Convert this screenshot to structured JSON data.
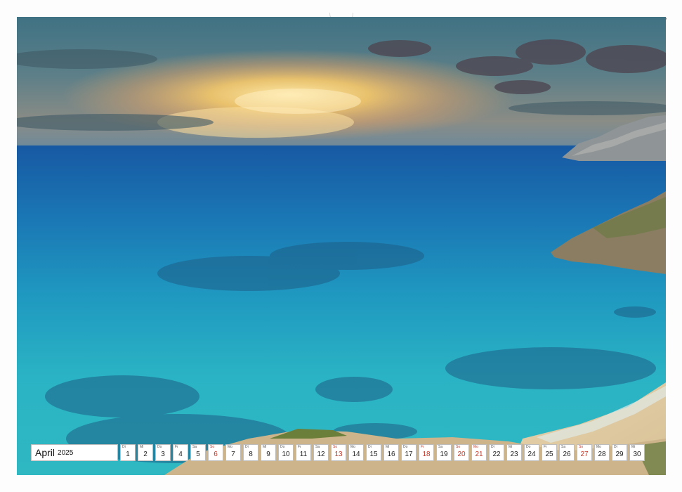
{
  "calendar": {
    "month": "April",
    "year": "2025",
    "days": [
      {
        "wd": "Di",
        "n": "1",
        "red": false
      },
      {
        "wd": "Mi",
        "n": "2",
        "red": false
      },
      {
        "wd": "Do",
        "n": "3",
        "red": false
      },
      {
        "wd": "Fr",
        "n": "4",
        "red": false
      },
      {
        "wd": "Sa",
        "n": "5",
        "red": false
      },
      {
        "wd": "So",
        "n": "6",
        "red": true
      },
      {
        "wd": "Mo",
        "n": "7",
        "red": false
      },
      {
        "wd": "Di",
        "n": "8",
        "red": false
      },
      {
        "wd": "Mi",
        "n": "9",
        "red": false
      },
      {
        "wd": "Do",
        "n": "10",
        "red": false
      },
      {
        "wd": "Fr",
        "n": "11",
        "red": false
      },
      {
        "wd": "Sa",
        "n": "12",
        "red": false
      },
      {
        "wd": "So",
        "n": "13",
        "red": true
      },
      {
        "wd": "Mo",
        "n": "14",
        "red": false
      },
      {
        "wd": "Di",
        "n": "15",
        "red": false
      },
      {
        "wd": "Mi",
        "n": "16",
        "red": false
      },
      {
        "wd": "Do",
        "n": "17",
        "red": false
      },
      {
        "wd": "Fr",
        "n": "18",
        "red": true
      },
      {
        "wd": "Sa",
        "n": "19",
        "red": false
      },
      {
        "wd": "So",
        "n": "20",
        "red": true
      },
      {
        "wd": "Mo",
        "n": "21",
        "red": true
      },
      {
        "wd": "Di",
        "n": "22",
        "red": false
      },
      {
        "wd": "Mi",
        "n": "23",
        "red": false
      },
      {
        "wd": "Do",
        "n": "24",
        "red": false
      },
      {
        "wd": "Fr",
        "n": "25",
        "red": false
      },
      {
        "wd": "Sa",
        "n": "26",
        "red": false
      },
      {
        "wd": "So",
        "n": "27",
        "red": true
      },
      {
        "wd": "Mo",
        "n": "28",
        "red": false
      },
      {
        "wd": "Di",
        "n": "29",
        "red": false
      },
      {
        "wd": "Mi",
        "n": "30",
        "red": false
      }
    ]
  },
  "colors": {
    "holiday_red": "#c0392b",
    "sea_turquoise": "#2ab3c4",
    "sea_deep": "#1667a8",
    "sky_gold": "#f6c86a"
  }
}
